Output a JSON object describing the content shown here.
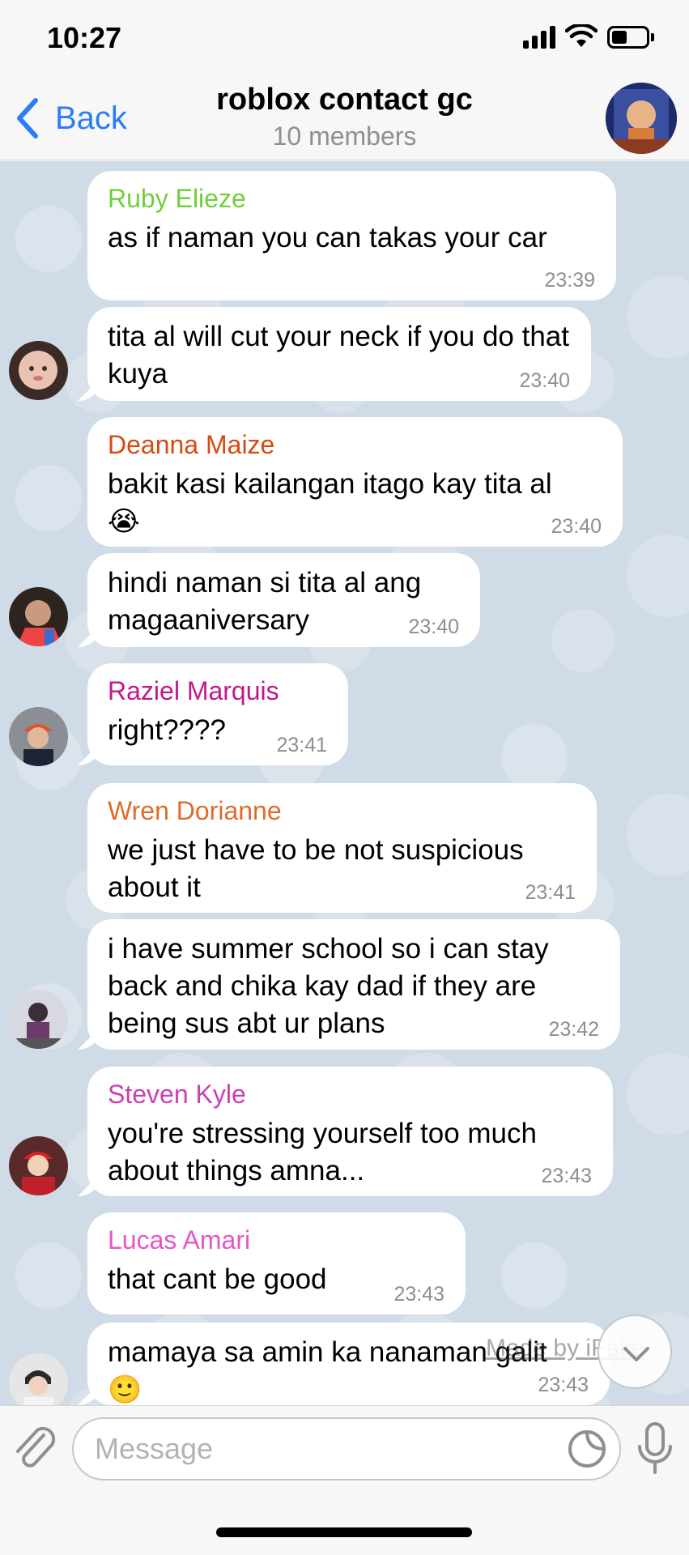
{
  "status_bar": {
    "time": "10:27",
    "battery_level": 0.45
  },
  "header": {
    "back_label": "Back",
    "title": "roblox contact gc",
    "subtitle": "10 members"
  },
  "messages": [
    {
      "sender": "Ruby Elieze",
      "sender_color": "#6fcf3a",
      "text": "as if naman you can takas your car",
      "time": "23:39"
    },
    {
      "sender": "",
      "text": "tita al will cut your neck if you do that kuya",
      "time": "23:40"
    },
    {
      "sender": "Deanna Maize",
      "sender_color": "#d9480f",
      "text": "bakit kasi kailangan itago kay tita al",
      "emoji": "😭",
      "time": "23:40"
    },
    {
      "sender": "",
      "text": "hindi naman si tita al ang magaaniversary",
      "time": "23:40"
    },
    {
      "sender": "Raziel Marquis",
      "sender_color": "#c2188b",
      "text": "right????",
      "time": "23:41"
    },
    {
      "sender": "Wren Dorianne",
      "sender_color": "#e06a2a",
      "text": "we just have to be not suspicious about it",
      "time": "23:41"
    },
    {
      "sender": "",
      "text": "i have summer school so i can stay back and chika kay dad if they are being sus abt ur plans",
      "time": "23:42"
    },
    {
      "sender": "Steven Kyle",
      "sender_color": "#cc3fb4",
      "text": "you're stressing yourself too much about things amna...",
      "time": "23:43"
    },
    {
      "sender": "Lucas Amari",
      "sender_color": "#e855c7",
      "text": "that cant be good",
      "time": "23:43"
    },
    {
      "sender": "",
      "text": "mamaya sa amin ka nanaman galit",
      "emoji": "🙂",
      "time": "23:43"
    }
  ],
  "watermark": "Made by iFake",
  "composer": {
    "placeholder": "Message"
  },
  "icons": [
    "back-chevron-icon",
    "paperclip-icon",
    "sticker-icon",
    "microphone-icon",
    "chevron-down-icon"
  ]
}
